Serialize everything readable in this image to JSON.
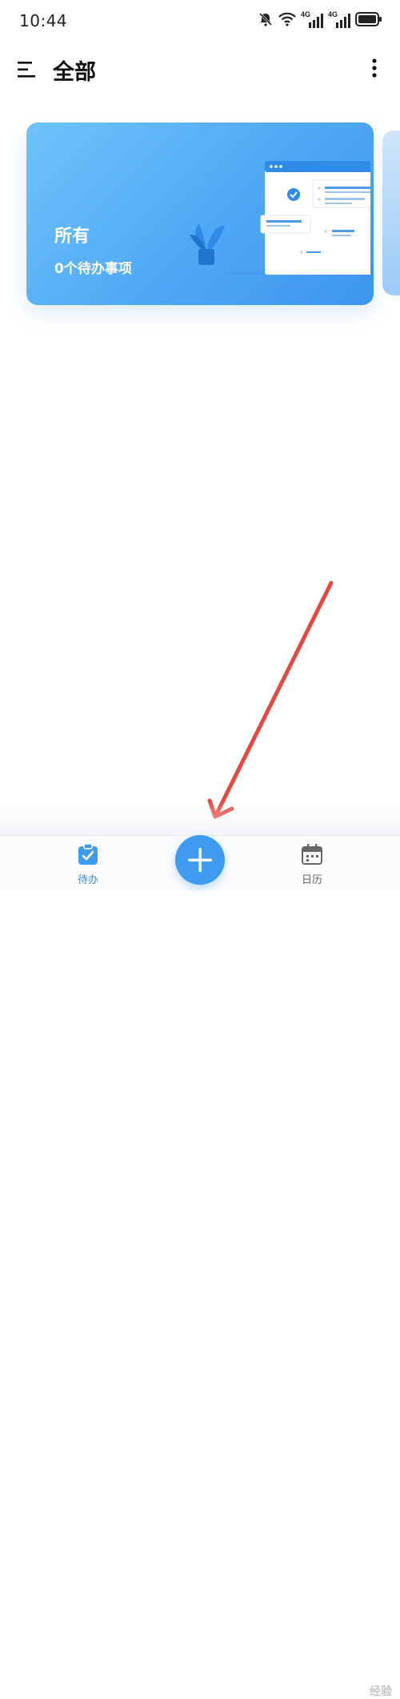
{
  "status_bar": {
    "time": "10:44",
    "network_1": "4G",
    "network_2": "4G",
    "icons": [
      "bell-muted-icon",
      "wifi-icon",
      "signal-icon",
      "signal-icon",
      "battery-icon"
    ]
  },
  "header": {
    "title": "全部",
    "menu_icon": "hamburger-icon",
    "more_icon": "more-vertical-icon"
  },
  "card": {
    "title": "所有",
    "subtitle": "0个待办事项"
  },
  "bottom_nav": {
    "items": [
      {
        "label": "待办",
        "icon": "todo-clipboard-icon",
        "active": true
      },
      {
        "label": "日历",
        "icon": "calendar-icon",
        "active": false
      }
    ],
    "fab_icon": "plus-icon"
  },
  "watermark": "经验",
  "colors": {
    "accent": "#3e9bf0",
    "card_start": "#6fc3fb",
    "card_end": "#3d96ee",
    "arrow": "#e5483f"
  }
}
